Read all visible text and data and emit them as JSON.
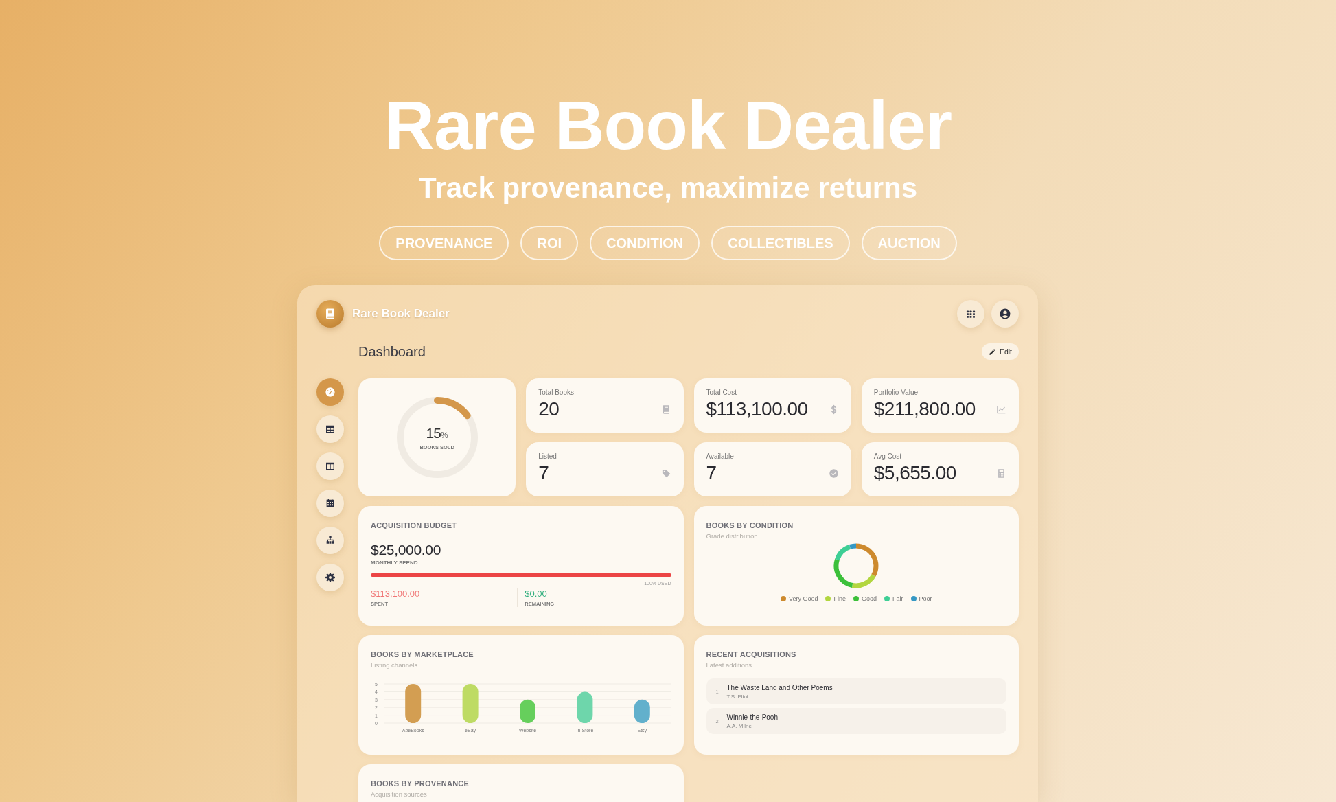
{
  "hero": {
    "title": "Rare Book Dealer",
    "subtitle": "Track provenance, maximize returns",
    "tags": [
      "PROVENANCE",
      "ROI",
      "CONDITION",
      "COLLECTIBLES",
      "AUCTION"
    ]
  },
  "app": {
    "name": "Rare Book Dealer",
    "page_title": "Dashboard",
    "edit_label": "Edit"
  },
  "header_buttons": [
    {
      "kind": "apps"
    },
    {
      "kind": "user"
    }
  ],
  "sidebar": {
    "items": [
      {
        "kind": "gauge",
        "selected": true
      },
      {
        "kind": "table",
        "selected": false
      },
      {
        "kind": "columns",
        "selected": false
      },
      {
        "kind": "calendar",
        "selected": false
      },
      {
        "kind": "sitemap",
        "selected": false
      },
      {
        "kind": "gear",
        "selected": false
      }
    ]
  },
  "sold_ring": {
    "value": "15",
    "unit": "%",
    "label": "BOOKS SOLD",
    "level": 0.15
  },
  "stats": [
    {
      "label": "Total Books",
      "value": "20",
      "kind": "book"
    },
    {
      "label": "Total Cost",
      "value": "$113,100.00",
      "kind": "dollar"
    },
    {
      "label": "Portfolio Value",
      "value": "$211,800.00",
      "kind": "chart"
    },
    {
      "label": "Listed",
      "value": "7",
      "kind": "tag"
    },
    {
      "label": "Available",
      "value": "7",
      "kind": "check"
    },
    {
      "label": "Avg Cost",
      "value": "$5,655.00",
      "kind": "calculator"
    }
  ],
  "budget": {
    "title": "ACQUISITION BUDGET",
    "amount": "$25,000.00",
    "amount_label": "MONTHLY SPEND",
    "level": 1,
    "used_label": "100% USED",
    "spent": "$113,100.00",
    "spent_label": "SPENT",
    "remaining": "$0.00",
    "remaining_label": "REMAINING"
  },
  "condition": {
    "title": "BOOKS BY CONDITION",
    "subtitle": "Grade distribution",
    "legend": [
      {
        "label": "Very Good",
        "color": "#cd8a2e"
      },
      {
        "label": "Fine",
        "color": "#b2d63f"
      },
      {
        "label": "Good",
        "color": "#3cc03a"
      },
      {
        "label": "Fair",
        "color": "#3ecf95"
      },
      {
        "label": "Poor",
        "color": "#3598c4"
      }
    ]
  },
  "marketplace": {
    "title": "BOOKS BY MARKETPLACE",
    "subtitle": "Listing channels",
    "chart_data": {
      "type": "bar",
      "categories": [
        "AbeBooks",
        "eBay",
        "Website",
        "In-Store",
        "Etsy"
      ],
      "values": [
        5,
        5,
        3,
        4,
        3
      ],
      "grid": true,
      "colors": [
        "#d39e52",
        "#bedb64",
        "#66cf5c",
        "#6ed6ab",
        "#62b0cc"
      ],
      "ylim": [
        0,
        5
      ],
      "yticks": [
        0,
        1,
        2,
        3,
        4,
        5
      ]
    }
  },
  "recent": {
    "title": "RECENT ACQUISITIONS",
    "subtitle": "Latest additions",
    "items": [
      {
        "index": "1",
        "title": "The Waste Land and Other Poems",
        "author": "T.S. Eliot"
      },
      {
        "index": "2",
        "title": "Winnie-the-Pooh",
        "author": "A.A. Milne"
      }
    ]
  },
  "provenance": {
    "title": "BOOKS BY PROVENANCE",
    "subtitle": "Acquisition sources"
  }
}
